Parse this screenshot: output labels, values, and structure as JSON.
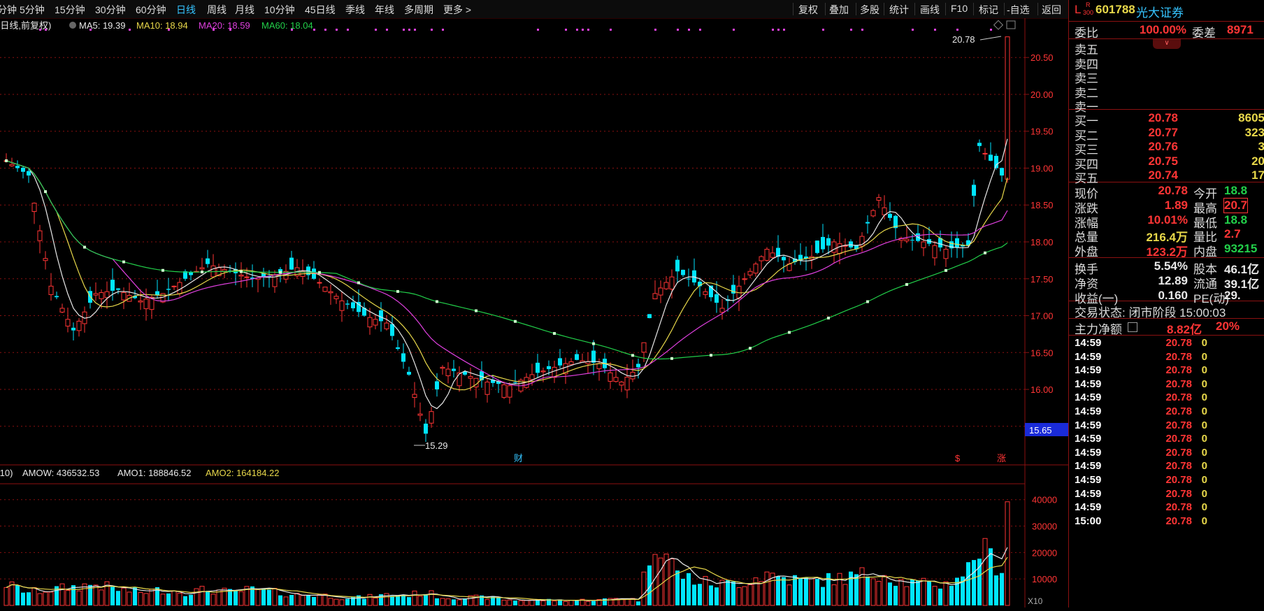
{
  "toolbar": {
    "periods": [
      "分钟",
      "5分钟",
      "15分钟",
      "30分钟",
      "60分钟",
      "日线",
      "周线",
      "月线",
      "10分钟",
      "45日线",
      "季线",
      "年线",
      "多周期",
      "更多 >"
    ],
    "active_period": "日线",
    "buttons": [
      "复权",
      "叠加",
      "多股",
      "统计",
      "画线",
      "F10",
      "标记",
      "-自选",
      "返回"
    ]
  },
  "main_chart": {
    "caption": "(日线,前复权)",
    "ma_labels": [
      {
        "text": "MA5: 19.39",
        "color": "#e8e8e8"
      },
      {
        "text": "MA10: 18.94",
        "color": "#e8d84a"
      },
      {
        "text": "MA20: 18.59",
        "color": "#e040e0"
      },
      {
        "text": "MA60: 18.04",
        "color": "#22d04a"
      }
    ],
    "price_axis": [
      "20.50",
      "20.00",
      "19.50",
      "19.00",
      "18.50",
      "18.00",
      "17.50",
      "17.00",
      "16.50",
      "16.00",
      "15.50"
    ],
    "high_marker": "20.78",
    "low_marker": "15.29",
    "cursor_price": "15.65",
    "event_markers": [
      {
        "label": "财",
        "color": "#35c4ff"
      },
      {
        "label": "$",
        "color": "#ff3535"
      },
      {
        "label": "涨",
        "color": "#ff3535"
      }
    ],
    "colors": {
      "up": "#ff3535",
      "down": "#00e5ff",
      "ma5": "#e8e8e8",
      "ma10": "#e8d84a",
      "ma20": "#e040e0",
      "ma60": "#22d04a",
      "grid": "#8b1111"
    }
  },
  "volume_chart": {
    "caption": ",10)",
    "labels": [
      {
        "text": "AMOW: 436532.53",
        "color": "#e8e8e8"
      },
      {
        "text": "AMO1: 188846.52",
        "color": "#e8e8e8"
      },
      {
        "text": "AMO2: 164184.22",
        "color": "#e8d84a"
      }
    ],
    "axis": [
      "40000",
      "30000",
      "20000",
      "10000"
    ],
    "unit": "X10"
  },
  "chart_data": {
    "type": "candlestick",
    "price_range": [
      15.1,
      20.9
    ],
    "volume_range": [
      0,
      46000
    ],
    "close_points": [
      [
        0,
        19.1
      ],
      [
        4,
        18.9
      ],
      [
        8,
        17.4
      ],
      [
        12,
        16.8
      ],
      [
        16,
        17.3
      ],
      [
        20,
        17.35
      ],
      [
        24,
        17.2
      ],
      [
        28,
        17.3
      ],
      [
        32,
        17.5
      ],
      [
        36,
        17.7
      ],
      [
        40,
        17.6
      ],
      [
        44,
        17.5
      ],
      [
        48,
        17.55
      ],
      [
        52,
        17.65
      ],
      [
        56,
        17.45
      ],
      [
        60,
        17.2
      ],
      [
        64,
        17.0
      ],
      [
        68,
        16.9
      ],
      [
        72,
        16.2
      ],
      [
        75,
        15.4
      ],
      [
        78,
        16.3
      ],
      [
        82,
        16.2
      ],
      [
        86,
        16.1
      ],
      [
        90,
        16.05
      ],
      [
        94,
        16.2
      ],
      [
        98,
        16.3
      ],
      [
        102,
        16.4
      ],
      [
        106,
        16.35
      ],
      [
        110,
        16.1
      ],
      [
        113,
        16.3
      ],
      [
        116,
        17.3
      ],
      [
        120,
        17.6
      ],
      [
        124,
        17.4
      ],
      [
        128,
        17.1
      ],
      [
        132,
        17.5
      ],
      [
        136,
        17.9
      ],
      [
        140,
        17.7
      ],
      [
        144,
        17.8
      ],
      [
        148,
        18.0
      ],
      [
        152,
        17.9
      ],
      [
        156,
        18.6
      ],
      [
        160,
        18.05
      ],
      [
        164,
        18.0
      ],
      [
        168,
        17.9
      ],
      [
        172,
        17.95
      ],
      [
        174,
        19.3
      ],
      [
        176,
        19.1
      ],
      [
        178,
        18.9
      ],
      [
        179,
        20.78
      ]
    ],
    "volume_points": [
      [
        0,
        8
      ],
      [
        4,
        5
      ],
      [
        8,
        6
      ],
      [
        12,
        7
      ],
      [
        16,
        8
      ],
      [
        20,
        6
      ],
      [
        24,
        5
      ],
      [
        28,
        6
      ],
      [
        32,
        5
      ],
      [
        36,
        6
      ],
      [
        40,
        5
      ],
      [
        44,
        6
      ],
      [
        48,
        5
      ],
      [
        52,
        4
      ],
      [
        56,
        4
      ],
      [
        60,
        3
      ],
      [
        64,
        3
      ],
      [
        68,
        4
      ],
      [
        72,
        4
      ],
      [
        75,
        5
      ],
      [
        78,
        3
      ],
      [
        82,
        3
      ],
      [
        86,
        3
      ],
      [
        90,
        2
      ],
      [
        94,
        2
      ],
      [
        98,
        2
      ],
      [
        102,
        2
      ],
      [
        106,
        2
      ],
      [
        110,
        3
      ],
      [
        113,
        2
      ],
      [
        116,
        27
      ],
      [
        120,
        12
      ],
      [
        124,
        9
      ],
      [
        128,
        8
      ],
      [
        132,
        9
      ],
      [
        136,
        12
      ],
      [
        140,
        10
      ],
      [
        144,
        9
      ],
      [
        148,
        10
      ],
      [
        152,
        11
      ],
      [
        156,
        13
      ],
      [
        160,
        9
      ],
      [
        164,
        8
      ],
      [
        168,
        8
      ],
      [
        172,
        14
      ],
      [
        174,
        22
      ],
      [
        176,
        18
      ],
      [
        178,
        14
      ],
      [
        179,
        44
      ]
    ]
  },
  "sidebar": {
    "header": {
      "prefix": "L",
      "badge_top": "R",
      "badge_bottom": "300",
      "code": "601788",
      "name": "光大证券"
    },
    "weibi": {
      "label": "委比",
      "value": "100.00%",
      "label2": "委差",
      "value2": "8971"
    },
    "asks": [
      "卖五",
      "卖四",
      "卖三",
      "卖二",
      "卖一"
    ],
    "bids": [
      {
        "label": "买一",
        "price": "20.78",
        "vol": "8605"
      },
      {
        "label": "买二",
        "price": "20.77",
        "vol": "323"
      },
      {
        "label": "买三",
        "price": "20.76",
        "vol": "3"
      },
      {
        "label": "买四",
        "price": "20.75",
        "vol": "20"
      },
      {
        "label": "买五",
        "price": "20.74",
        "vol": "17"
      }
    ],
    "quote": [
      {
        "l1": "现价",
        "v1": "20.78",
        "c1": "red",
        "l2": "今开",
        "v2": "18.8",
        "c2": "green"
      },
      {
        "l1": "涨跌",
        "v1": "1.89",
        "c1": "red",
        "l2": "最高",
        "v2": "20.7",
        "c2": "red"
      },
      {
        "l1": "涨幅",
        "v1": "10.01%",
        "c1": "red",
        "l2": "最低",
        "v2": "18.8",
        "c2": "green"
      },
      {
        "l1": "总量",
        "v1": "216.4万",
        "c1": "yellow",
        "l2": "量比",
        "v2": "2.7",
        "c2": "red"
      },
      {
        "l1": "外盘",
        "v1": "123.2万",
        "c1": "red",
        "l2": "内盘",
        "v2": "93215",
        "c2": "green"
      }
    ],
    "stats": [
      {
        "l1": "换手",
        "v1": "5.54%",
        "l2": "股本",
        "v2": "46.1亿"
      },
      {
        "l1": "净资",
        "v1": "12.89",
        "l2": "流通",
        "v2": "39.1亿"
      },
      {
        "l1": "收益(一)",
        "v1": "0.160",
        "l2": "PE(动)",
        "v2": "29."
      }
    ],
    "trade_status": "交易状态: 闭市阶段 15:00:03",
    "main_flow": {
      "label": "主力净额",
      "value": "8.82亿",
      "extra": "20%"
    },
    "ticks": [
      {
        "time": "14:59",
        "price": "20.78",
        "vol": "0"
      },
      {
        "time": "14:59",
        "price": "20.78",
        "vol": "0"
      },
      {
        "time": "14:59",
        "price": "20.78",
        "vol": "0"
      },
      {
        "time": "14:59",
        "price": "20.78",
        "vol": "0"
      },
      {
        "time": "14:59",
        "price": "20.78",
        "vol": "0"
      },
      {
        "time": "14:59",
        "price": "20.78",
        "vol": "0"
      },
      {
        "time": "14:59",
        "price": "20.78",
        "vol": "0"
      },
      {
        "time": "14:59",
        "price": "20.78",
        "vol": "0"
      },
      {
        "time": "14:59",
        "price": "20.78",
        "vol": "0"
      },
      {
        "time": "14:59",
        "price": "20.78",
        "vol": "0"
      },
      {
        "time": "14:59",
        "price": "20.78",
        "vol": "0"
      },
      {
        "time": "14:59",
        "price": "20.78",
        "vol": "0"
      },
      {
        "time": "14:59",
        "price": "20.78",
        "vol": "0"
      },
      {
        "time": "15:00",
        "price": "20.78",
        "vol": "0"
      }
    ]
  }
}
